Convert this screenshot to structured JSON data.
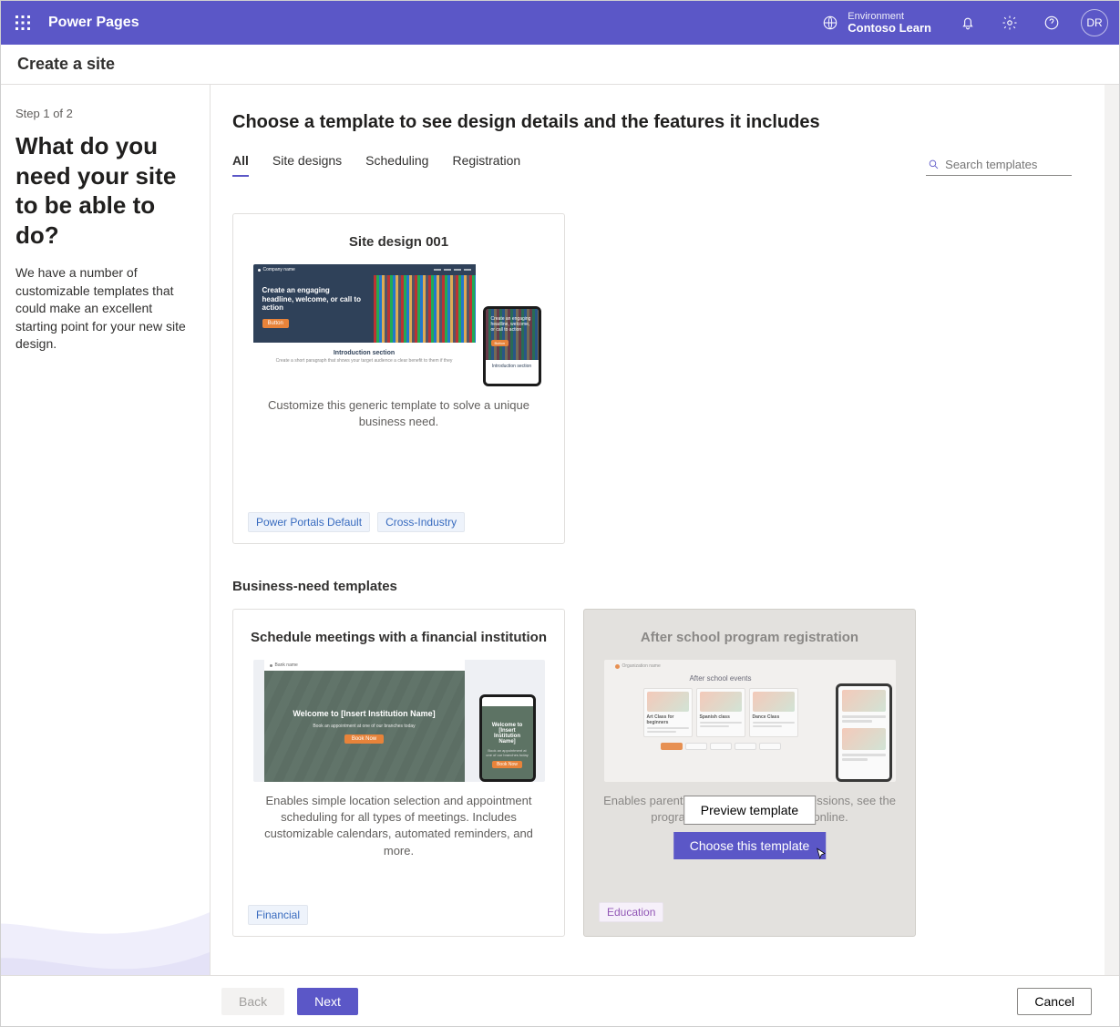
{
  "header": {
    "brand": "Power Pages",
    "env_label": "Environment",
    "env_name": "Contoso Learn",
    "avatar": "DR"
  },
  "subheader": "Create a site",
  "left": {
    "step": "Step 1 of 2",
    "heading": "What do you need your site to be able to do?",
    "body": "We have a number of customizable templates that could make an excellent starting point for your new site design."
  },
  "main": {
    "lead": "Choose a template to see design details and the features it includes",
    "tabs": [
      "All",
      "Site designs",
      "Scheduling",
      "Registration"
    ],
    "search_placeholder": "Search templates",
    "card1": {
      "title": "Site design 001",
      "desc": "Customize this generic template to solve a unique business need.",
      "tags": [
        "Power Portals Default",
        "Cross-Industry"
      ],
      "preview_headline": "Create an engaging headline, welcome, or call to action",
      "preview_btn": "Button",
      "preview_intro_title": "Introduction section",
      "preview_intro_sub": "Create a short paragraph that shows your target audience a clear benefit to them if they"
    },
    "section_title": "Business-need templates",
    "card2": {
      "title": "Schedule meetings with a financial institution",
      "desc": "Enables simple location selection and appointment scheduling for all types of meetings. Includes customizable calendars, automated reminders, and more.",
      "tags": [
        "Financial"
      ],
      "preview_title": "Welcome to [Insert Institution Name]",
      "preview_sub": "Book an appointment at one of our branches today",
      "preview_btn": "Book Now"
    },
    "card3": {
      "title": "After school program registration",
      "desc": "Enables parents to visualize available sessions, see the program capacity, and register online.",
      "tags": [
        "Education"
      ],
      "preview_title": "After school events",
      "tiles": [
        "Art Class for beginners",
        "Spanish class",
        "Dance Class"
      ],
      "preview_btn": "Preview template",
      "choose_btn": "Choose this template"
    }
  },
  "footer": {
    "back": "Back",
    "next": "Next",
    "cancel": "Cancel"
  }
}
